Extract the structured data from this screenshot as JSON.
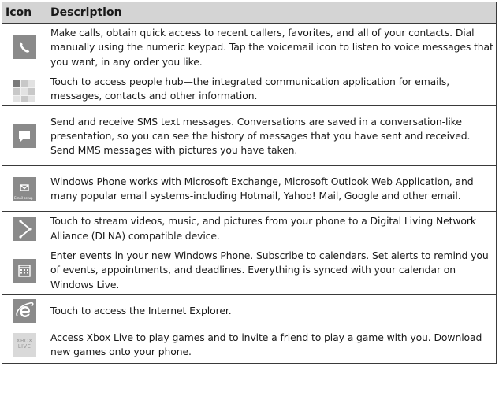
{
  "table": {
    "headers": {
      "icon": "Icon",
      "description": "Description"
    },
    "rows": [
      {
        "icon": "phone-icon",
        "description": "Make calls, obtain quick access to recent callers, favorites, and all of your contacts. Dial manually using the numeric keypad. Tap the voicemail icon to listen to voice messages that you want, in any order you like."
      },
      {
        "icon": "people-hub-icon",
        "description": "Touch to access people hub—the integrated communication application for emails, messages, contacts and other information."
      },
      {
        "icon": "messaging-icon",
        "description": "Send and receive SMS text messages. Conversations are saved in a conversation-like presentation, so you can see the history of messages that you have sent and received. Send MMS messages with pictures you have taken."
      },
      {
        "icon": "email-setup-icon",
        "icon_caption": "Email setup",
        "description": "Windows Phone works with Microsoft Exchange, Microsoft Outlook Web Application, and many popular email systems-including Hotmail, Yahoo! Mail, Google and other email."
      },
      {
        "icon": "play-to-icon",
        "description": "Touch to stream videos, music, and pictures from your phone to a Digital Living Network Alliance (DLNA) compatible device."
      },
      {
        "icon": "calendar-icon",
        "description": "Enter events in your new Windows Phone. Subscribe to calendars. Set alerts to remind you of events, appointments, and deadlines. Everything is synced with your calendar on Windows Live."
      },
      {
        "icon": "internet-explorer-icon",
        "description": "Touch to access the Internet Explorer."
      },
      {
        "icon": "xbox-live-icon",
        "icon_caption": "XBOX LIVE",
        "description": "Access Xbox Live to play games and to invite a friend to play a game with you. Download new games onto your phone."
      }
    ]
  },
  "colors": {
    "header_bg": "#d4d4d4",
    "tile_gray": "#8a8a8a",
    "border": "#3a3a3a"
  }
}
